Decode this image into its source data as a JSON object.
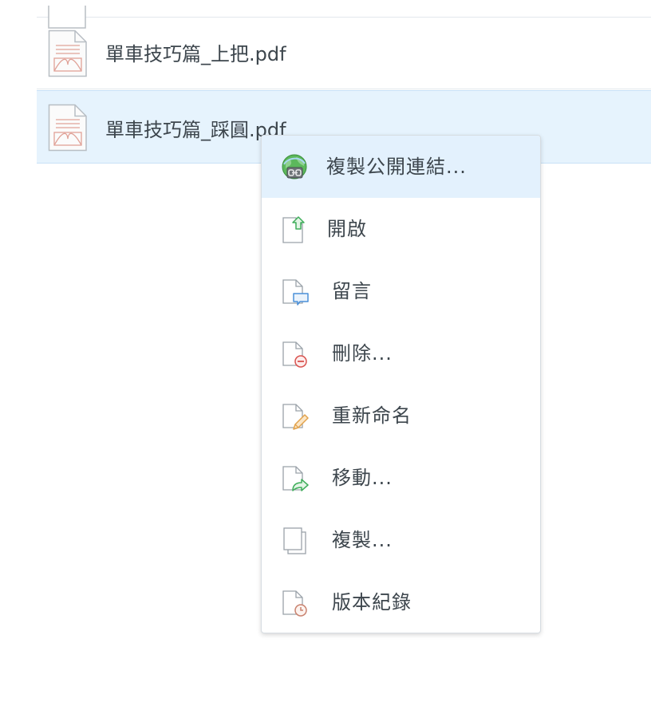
{
  "files": {
    "rows": [
      {
        "name": "單車技巧篇_上把.pdf",
        "selected": false,
        "icon": "pdf-file-icon"
      },
      {
        "name": "單車技巧篇_踩圓.pdf",
        "selected": true,
        "icon": "pdf-file-icon"
      }
    ]
  },
  "context_menu": {
    "items": [
      {
        "label": "複製公開連結...",
        "icon": "globe-link-icon",
        "highlighted": true
      },
      {
        "label": "開啟",
        "icon": "open-file-icon"
      },
      {
        "label": "留言",
        "icon": "comment-file-icon"
      },
      {
        "label": "刪除...",
        "icon": "delete-file-icon"
      },
      {
        "label": "重新命名",
        "icon": "rename-file-icon"
      },
      {
        "label": "移動...",
        "icon": "move-file-icon"
      },
      {
        "label": "複製...",
        "icon": "copy-file-icon"
      },
      {
        "label": "版本紀錄",
        "icon": "version-history-icon"
      }
    ]
  },
  "colors": {
    "selection_bg": "#e6f3fd",
    "menu_highlight_bg": "#e3f1fd",
    "pdf_accent": "#e0a298",
    "icon_green": "#3fae5a",
    "icon_blue": "#4a90d9",
    "icon_red": "#d9534f",
    "icon_orange": "#e2a24b"
  }
}
